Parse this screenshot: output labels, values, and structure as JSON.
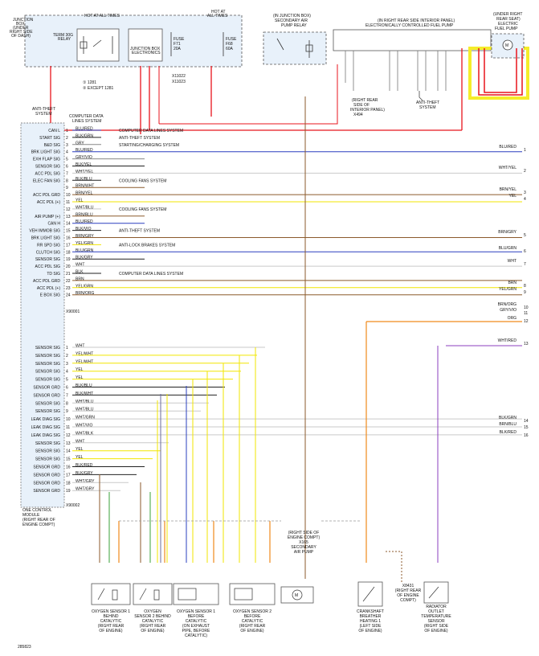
{
  "junction_box": {
    "title": [
      "JUNCTION",
      "BOX",
      "(UNDER",
      "RIGHT SIDE",
      "OF DASH)"
    ],
    "hot_at_all_times": "HOT AT ALL TIMES",
    "hot_at_all_times_2": [
      "HOT AT",
      "ALL TIMES"
    ],
    "term_relay": [
      "TERM 30G",
      "RELAY"
    ],
    "jb_electronics": [
      "JUNCTION BOX",
      "ELECTRONICS"
    ],
    "fuse_f71": [
      "FUSE",
      "F71",
      "20A"
    ],
    "fuse_f68": [
      "FUSE",
      "F68",
      "60A"
    ],
    "connectors": [
      "X11022",
      "X11023"
    ],
    "note_1": "① 1281",
    "note_2": "② EXCEPT 1281"
  },
  "secondary_air_relay": [
    "(IN JUNCTION BOX)",
    "SECONDARY AIR",
    "PUMP RELAY"
  ],
  "fuel_pump_module": [
    "(IN RIGHT REAR SIDE INTERIOR PANEL)",
    "ELECTRONICALLY CONTROLLED FUEL PUMP"
  ],
  "electric_fuel_pump": [
    "(UNDER RIGHT",
    "REAR SEAT)",
    "ELECTRIC",
    "FUEL PUMP"
  ],
  "labels": {
    "antitheft_left": [
      "ANTI-THEFT",
      "SYSTEM"
    ],
    "antitheft_right": [
      "ANTI-THEFT",
      "SYSTEM"
    ],
    "right_rear_panel": [
      "(RIGHT REAR",
      "SIDE OF",
      "INTERIOR PANEL)",
      "X494"
    ],
    "computer_data": [
      "COMPUTER DATA",
      "LINES SYSTEM"
    ],
    "x90001": "X90001",
    "x90002": "X90002",
    "figure_id": "285823"
  },
  "pcm": {
    "title": [
      "ONE CONTROL",
      "MODULE",
      "(RIGHT REAR OF",
      "ENGINE COMPT)"
    ],
    "pins": [
      {
        "name": "CAN L",
        "n": "1",
        "wire": "BLU/RED",
        "dest": "COMPUTER DATA LINES SYSTEM",
        "right": ""
      },
      {
        "name": "START SIG",
        "n": "2",
        "wire": "BLK/GRN",
        "dest": "ANTI-THEFT SYSTEM",
        "right": ""
      },
      {
        "name": "B&D SIG",
        "n": "3",
        "wire": "GRY",
        "dest": "STARTING/CHARGING SYSTEM",
        "right": ""
      },
      {
        "name": "BRK LIGHT SIG",
        "n": "4",
        "wire": "BLU/RED",
        "dest": "",
        "right": "BLU/RED"
      },
      {
        "name": "EXH FLAP SIG",
        "n": "5",
        "wire": "GRY/VIO",
        "dest": "",
        "right": ""
      },
      {
        "name": "SENSOR SIG",
        "n": "6",
        "wire": "BLK/YEL",
        "dest": "",
        "right": ""
      },
      {
        "name": "ACC PDL SIG",
        "n": "7",
        "wire": "WHT/YEL",
        "dest": "",
        "right": "WHT/YEL"
      },
      {
        "name": "ELEC FAN SIG",
        "n": "8",
        "wire": "BLK/BLU",
        "dest": "COOLING FANS SYSTEM",
        "right": ""
      },
      {
        "name": "",
        "n": "9",
        "wire": "BRN/WHT",
        "dest": "",
        "right": ""
      },
      {
        "name": "ACC PDL GRD",
        "n": "10",
        "wire": "BRN/YEL",
        "dest": "",
        "right": "BRN/YEL"
      },
      {
        "name": "ACC PDL (+)",
        "n": "11",
        "wire": "YEL",
        "dest": "",
        "right": "YEL"
      },
      {
        "name": "",
        "n": "12",
        "wire": "WHT/BLU",
        "dest": "COOLING FANS SYSTEM",
        "right": ""
      },
      {
        "name": "AIR PUMP (+)",
        "n": "13",
        "wire": "BRN/BLU",
        "dest": "",
        "right": ""
      },
      {
        "name": "CAN H",
        "n": "14",
        "wire": "BLU/RED",
        "dest": "",
        "right": ""
      },
      {
        "name": "VEH IMMOB SIG",
        "n": "15",
        "wire": "BLK/VIO",
        "dest": "ANTI-THEFT SYSTEM",
        "right": ""
      },
      {
        "name": "BRK LIGHT SIG",
        "n": "16",
        "wire": "BRN/GRY",
        "dest": "",
        "right": "BRN/GRY"
      },
      {
        "name": "RR SPD SIG",
        "n": "17",
        "wire": "YEL/GRN",
        "dest": "ANTI-LOCK BRAKES SYSTEM",
        "right": ""
      },
      {
        "name": "CLUTCH SIG",
        "n": "18",
        "wire": "BLU/GRN",
        "dest": "",
        "right": "BLU/GRN"
      },
      {
        "name": "SENSOR SIG",
        "n": "19",
        "wire": "BLK/GRY",
        "dest": "",
        "right": ""
      },
      {
        "name": "ACC PDL SIG",
        "n": "20",
        "wire": "WHT",
        "dest": "",
        "right": "WHT"
      },
      {
        "name": "TD SIG",
        "n": "21",
        "wire": "BLK",
        "dest": "COMPUTER DATA LINES SYSTEM",
        "right": ""
      },
      {
        "name": "ACC PDL GRD",
        "n": "22",
        "wire": "BRN",
        "dest": "",
        "right": "BRN"
      },
      {
        "name": "ACC PDL (+)",
        "n": "23",
        "wire": "YEL/GRN",
        "dest": "",
        "right": "YEL/GRN"
      },
      {
        "name": "E BOX SIG",
        "n": "24",
        "wire": "BRN/ORG",
        "dest": "",
        "right": "BRN/ORG"
      }
    ],
    "pins2": [
      {
        "name": "SENSOR SIG",
        "n": "1",
        "wire": "WHT"
      },
      {
        "name": "SENSOR SIG",
        "n": "2",
        "wire": "YEL/WHT"
      },
      {
        "name": "SENSOR SIG",
        "n": "3",
        "wire": "YEL/WHT"
      },
      {
        "name": "SENSOR SIG",
        "n": "4",
        "wire": "YEL"
      },
      {
        "name": "SENSOR SIG",
        "n": "5",
        "wire": "YEL"
      },
      {
        "name": "SENSOR GRD",
        "n": "6",
        "wire": "BLK/BLU"
      },
      {
        "name": "SENSOR GRD",
        "n": "7",
        "wire": "BLK/WHT"
      },
      {
        "name": "SENSOR SIG",
        "n": "8",
        "wire": "WHT/BLU"
      },
      {
        "name": "SENSOR SIG",
        "n": "9",
        "wire": "WHT/BLU"
      },
      {
        "name": "LEAK DIAG SIG",
        "n": "10",
        "wire": "WHT/GRN"
      },
      {
        "name": "LEAK DIAG SIG",
        "n": "11",
        "wire": "WHT/VIO"
      },
      {
        "name": "LEAK DIAG SIG",
        "n": "12",
        "wire": "WHT/BLK"
      },
      {
        "name": "SENSOR SIG",
        "n": "13",
        "wire": "WHT"
      },
      {
        "name": "SENSOR SIG",
        "n": "14",
        "wire": "YEL"
      },
      {
        "name": "SENSOR SIG",
        "n": "15",
        "wire": "YEL"
      },
      {
        "name": "SENSOR GRD",
        "n": "16",
        "wire": "BLK/RED"
      },
      {
        "name": "SENSOR GRD",
        "n": "17",
        "wire": "BLK/GRY"
      },
      {
        "name": "SENSOR GRD",
        "n": "18",
        "wire": "WHT/GRY"
      },
      {
        "name": "SENSOR GRD",
        "n": "19",
        "wire": "WHT/GRY"
      }
    ]
  },
  "right_edge": {
    "wires": [
      "BLU/RED",
      "WHT/YEL",
      "BRN/YEL",
      "YEL",
      "BRN/GRY",
      "BLU/GRN",
      "WHT",
      "BRN",
      "YEL/GRN",
      "BRN/ORG",
      "GRY/VIO",
      "ORG",
      "WHT/RED",
      "BLK/GRN",
      "BRN/BLU",
      "BLK/RED"
    ],
    "nums": [
      "1",
      "2",
      "3",
      "4",
      "5",
      "6",
      "7",
      "8",
      "9",
      "10",
      "11",
      "12",
      "13",
      "14",
      "15",
      "16"
    ]
  },
  "components": [
    [
      "OXYGEN SENSOR 1",
      "BEHIND",
      "CATALYTIC",
      "(RIGHT REAR",
      "OF ENGINE)"
    ],
    [
      "OXYGEN",
      "SENSOR 2 BEHIND",
      "CATALYTIC",
      "(RIGHT REAR",
      "OF ENGINE)"
    ],
    [
      "OXYGEN SENSOR 1",
      "BEFORE",
      "CATALYTIC",
      "(ON EXHAUST",
      "PIPE, BEFORE",
      "CATALYTIC)"
    ],
    [
      "OXYGEN SENSOR 2",
      "BEFORE",
      "CATALYTIC",
      "(RIGHT REAR",
      "OF ENGINE)"
    ],
    [
      "(RIGHT SIDE OF",
      "ENGINE COMPT)",
      "X165",
      "SECONDARY",
      "AIR PUMP"
    ],
    [
      "CRANKSHAFT",
      "BREATHER",
      "HEATING 1",
      "(LEFT SIDE",
      "OF ENGINE)"
    ],
    [
      "X8431",
      "(RIGHT REAR",
      "OF ENGINE",
      "COMPT)"
    ],
    [
      "RADIATOR",
      "OUTLET",
      "TEMPERATURE",
      "SENSOR",
      "(RIGHT SIDE",
      "OF ENGINE)"
    ]
  ],
  "colors": {
    "red": "#e8141c",
    "yellow": "#f2e600",
    "blue": "#2a3fbf",
    "orange": "#f08a1c",
    "brown": "#8b5a2b",
    "violet": "#8b3fbf",
    "green": "#3aa03a",
    "white_wire": "#c9c9c9",
    "pcm_fill": "#e8f1fa",
    "highlight": "#f5ec2a"
  }
}
